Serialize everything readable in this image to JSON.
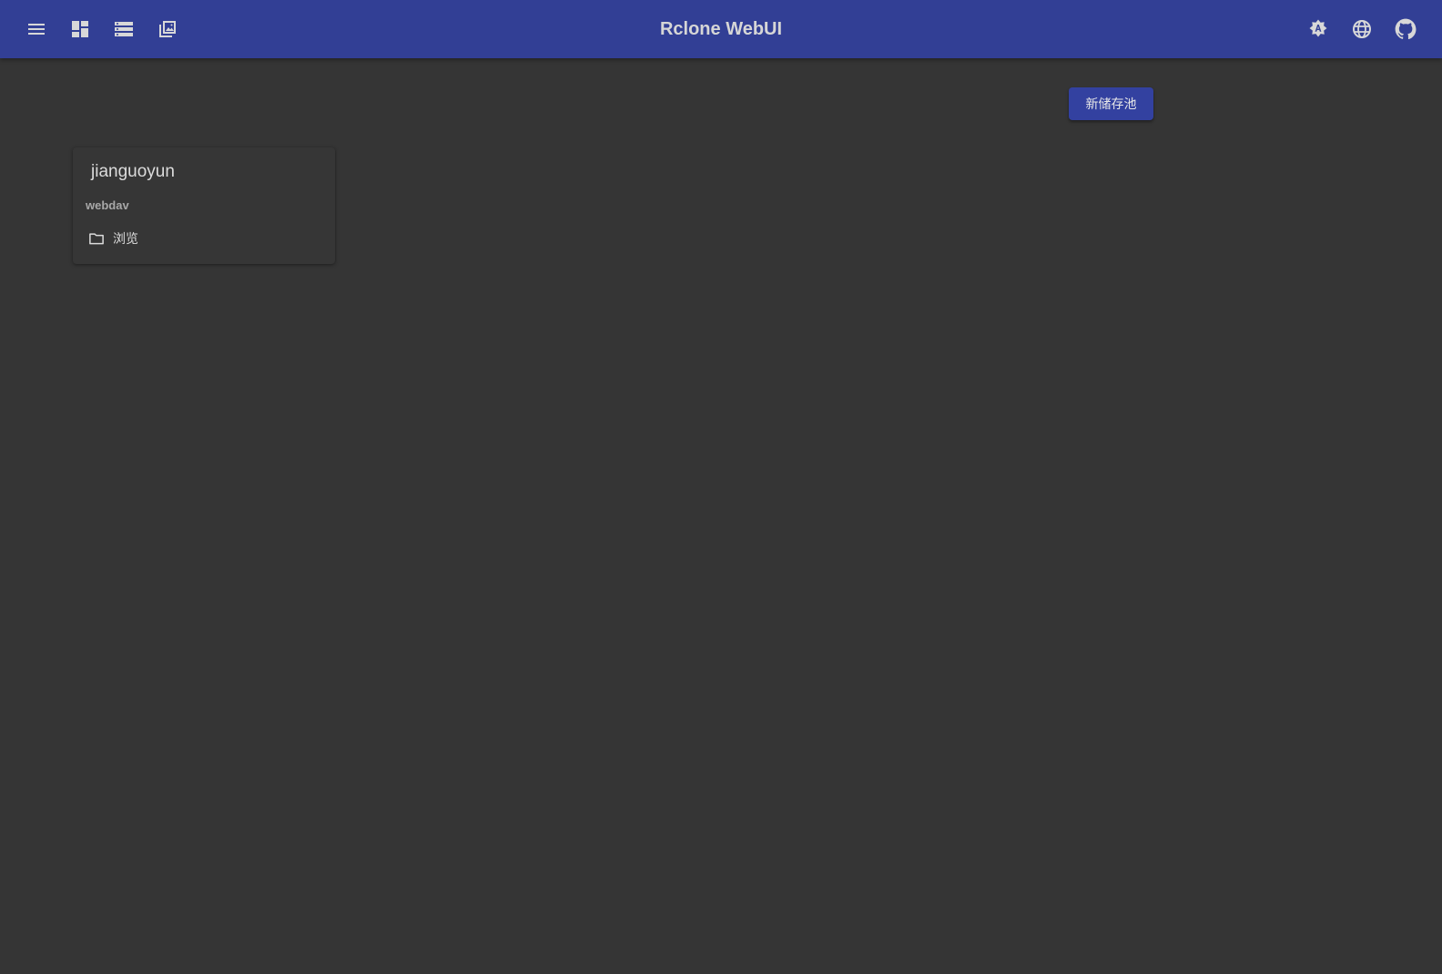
{
  "header": {
    "title": "Rclone WebUI",
    "left_icons": [
      "menu-icon",
      "dashboard-icon",
      "storage-icon",
      "explorer-icon"
    ],
    "right_icons": [
      "theme-toggle-icon",
      "language-icon",
      "github-icon"
    ],
    "background": "#323f95"
  },
  "main": {
    "new_remote_label": "新储存池",
    "remotes": [
      {
        "name": "jianguoyun",
        "type": "webdav",
        "browse_label": "浏览",
        "browse_icon": "folder-icon"
      }
    ]
  }
}
